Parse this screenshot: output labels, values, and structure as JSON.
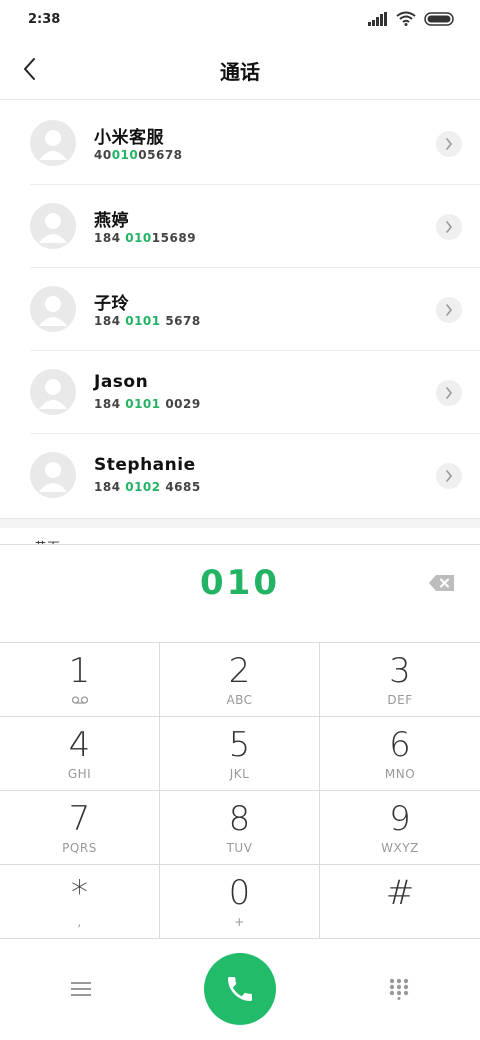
{
  "status_bar": {
    "time": "2:38"
  },
  "header": {
    "title": "通话"
  },
  "contacts": [
    {
      "name": "小米客服",
      "number_pre": "40",
      "number_hl": "010",
      "number_post": "05678"
    },
    {
      "name": "燕婷",
      "number_pre": "184 ",
      "number_hl": "010",
      "number_post": "15689"
    },
    {
      "name": "子玲",
      "number_pre": "184 ",
      "number_hl": "0101",
      "number_post": " 5678"
    },
    {
      "name": "Jason",
      "number_pre": "184 ",
      "number_hl": "0101",
      "number_post": " 0029"
    },
    {
      "name": "Stephanie",
      "number_pre": "184 ",
      "number_hl": "0102",
      "number_post": " 4685"
    }
  ],
  "section_peek": {
    "label": "黄页"
  },
  "dialer": {
    "dialed_number": "010"
  },
  "keypad": [
    {
      "digit": "1",
      "letters": ""
    },
    {
      "digit": "2",
      "letters": "ABC"
    },
    {
      "digit": "3",
      "letters": "DEF"
    },
    {
      "digit": "4",
      "letters": "GHI"
    },
    {
      "digit": "5",
      "letters": "JKL"
    },
    {
      "digit": "6",
      "letters": "MNO"
    },
    {
      "digit": "7",
      "letters": "PQRS"
    },
    {
      "digit": "8",
      "letters": "TUV"
    },
    {
      "digit": "9",
      "letters": "WXYZ"
    },
    {
      "digit": "*",
      "letters": ","
    },
    {
      "digit": "0",
      "letters": "+"
    },
    {
      "digit": "#",
      "letters": ""
    }
  ],
  "colors": {
    "accent": "#22b464",
    "call_button": "#22bb6a"
  },
  "icons": {
    "status": [
      "signal-icon",
      "wifi-icon",
      "battery-icon"
    ],
    "header": "back-arrow-icon",
    "row": "chevron-right-icon",
    "key1": "voicemail-icon",
    "dialer": "backspace-icon",
    "bottom": [
      "menu-icon",
      "phone-icon",
      "dialpad-icon"
    ]
  }
}
